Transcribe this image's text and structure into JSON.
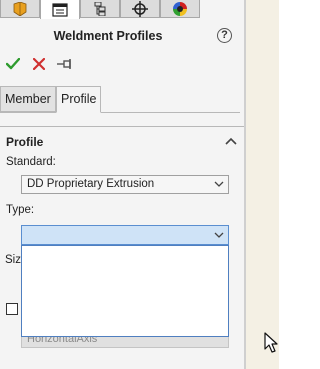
{
  "panel": {
    "title": "Weldment Profiles",
    "help_symbol": "?"
  },
  "top_tabs": [
    {
      "name": "weldment-icon",
      "active": false
    },
    {
      "name": "property-manager-icon",
      "active": true
    },
    {
      "name": "configuration-manager-icon",
      "active": false
    },
    {
      "name": "dimxpert-icon",
      "active": false
    },
    {
      "name": "appearance-icon",
      "active": false
    }
  ],
  "actions": {
    "ok_icon": "checkmark-icon",
    "cancel_icon": "x-icon",
    "pin_icon": "pushpin-icon"
  },
  "sub_tabs": {
    "member": "Member",
    "profile": "Profile"
  },
  "profile_section": {
    "title": "Profile",
    "standard_label": "Standard:",
    "standard_value": "DD Proprietary Extrusion",
    "type_label": "Type:",
    "type_value": "",
    "size_label_partial": "Siz",
    "axis_value_partial": "HorizontalAxis"
  },
  "colors": {
    "ok": "#2e9b2e",
    "cancel": "#d03030",
    "focus": "#cfe3f7",
    "focus_border": "#5a8ed0"
  }
}
